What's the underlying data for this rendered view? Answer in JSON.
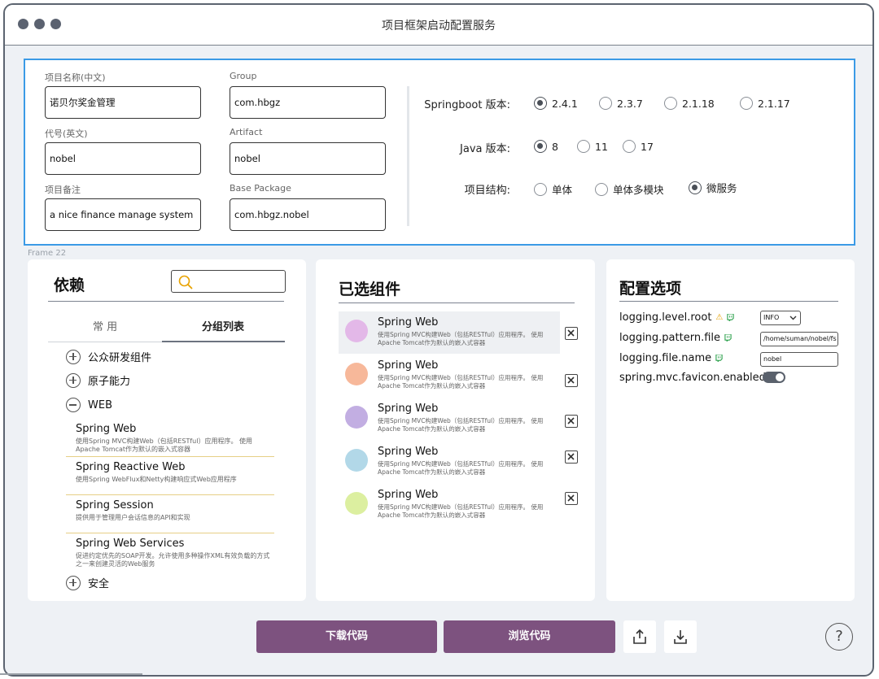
{
  "window": {
    "title": "项目框架启动配置服务"
  },
  "project": {
    "fields": [
      {
        "label": "项目名称(中文)",
        "value": "诺贝尔奖金管理"
      },
      {
        "label": "Group",
        "value": "com.hbgz"
      },
      {
        "label": "代号(英文)",
        "value": "nobel"
      },
      {
        "label": "Artifact",
        "value": "nobel"
      },
      {
        "label": "项目备注",
        "value": "a nice finance manage system"
      },
      {
        "label": "Base Package",
        "value": "com.hbgz.nobel"
      }
    ],
    "springboot": {
      "label": "Springboot 版本:",
      "options": [
        "2.4.1",
        "2.3.7",
        "2.1.18",
        "2.1.17"
      ],
      "selected": 0
    },
    "java": {
      "label": "Java 版本:",
      "options": [
        "8",
        "11",
        "17"
      ],
      "selected": 0
    },
    "structure": {
      "label": "项目结构:",
      "options": [
        "单体",
        "单体多模块",
        "微服务"
      ],
      "selected": 2
    }
  },
  "frame_caption": "Frame 22",
  "deps": {
    "title": "依赖",
    "tabs": [
      "常 用",
      "分组列表"
    ],
    "groups": [
      "公众研发组件",
      "原子能力",
      "WEB",
      "安全"
    ],
    "items": [
      {
        "name": "Spring Web",
        "desc": "使用Spring MVC构建Web（包括RESTful）应用程序。 使用Apache Tomcat作为默认的嵌入式容器"
      },
      {
        "name": "Spring Reactive Web",
        "desc": "使用Spring WebFlux和Netty构建响应式Web应用程序"
      },
      {
        "name": "Spring Session",
        "desc": "提供用于管理用户会话信息的API和实现"
      },
      {
        "name": "Spring Web Services",
        "desc": "促进约定优先的SOAP开发。允许使用多种操作XML有效负载的方式之一来创建灵活的Web服务"
      }
    ]
  },
  "selected": {
    "title": "已选组件",
    "items": [
      {
        "name": "Spring Web",
        "desc": "使用Spring MVC构建Web（包括RESTful）应用程序。 使用Apache Tomcat作为默认的嵌入式容器",
        "color": "#e3b8e8"
      },
      {
        "name": "Spring Web",
        "desc": "使用Spring MVC构建Web（包括RESTful）应用程序。 使用Apache Tomcat作为默认的嵌入式容器",
        "color": "#f7b89a"
      },
      {
        "name": "Spring Web",
        "desc": "使用Spring MVC构建Web（包括RESTful）应用程序。 使用Apache Tomcat作为默认的嵌入式容器",
        "color": "#c2aee2"
      },
      {
        "name": "Spring Web",
        "desc": "使用Spring MVC构建Web（包括RESTful）应用程序。 使用Apache Tomcat作为默认的嵌入式容器",
        "color": "#b2d8e8"
      },
      {
        "name": "Spring Web",
        "desc": "使用Spring MVC构建Web（包括RESTful）应用程序。 使用Apache Tomcat作为默认的嵌入式容器",
        "color": "#dcefa0"
      }
    ]
  },
  "config": {
    "title": "配置选项",
    "items": [
      {
        "key": "logging.level.root",
        "value": "INFO"
      },
      {
        "key": "logging.pattern.file",
        "value": "/home/suman/nobel/fs"
      },
      {
        "key": "logging.file.name",
        "value": "nobel"
      },
      {
        "key": "spring.mvc.favicon.enabled",
        "value": ""
      }
    ]
  },
  "actions": {
    "download": "下载代码",
    "browse": "浏览代码",
    "help": "?"
  },
  "colors": {
    "accent": "#3b9ae6",
    "button": "#7d527f"
  }
}
